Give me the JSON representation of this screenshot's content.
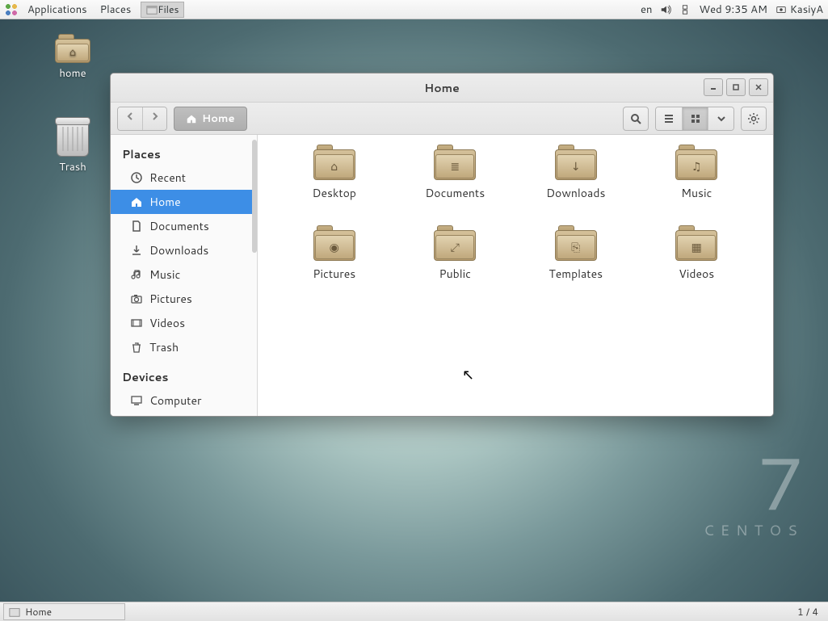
{
  "top_panel": {
    "applications": "Applications",
    "places": "Places",
    "task": "Files",
    "lang": "en",
    "clock": "Wed  9:35 AM",
    "user": "KasiyA"
  },
  "desktop": {
    "home": "home",
    "trash": "Trash"
  },
  "brand": {
    "seven": "7",
    "name": "CENTOS"
  },
  "bottom": {
    "task": "Home",
    "workspace": "1 / 4"
  },
  "window": {
    "title": "Home",
    "path_label": "Home",
    "sidebar": {
      "places_header": "Places",
      "devices_header": "Devices",
      "places": [
        {
          "icon": "clock",
          "label": "Recent"
        },
        {
          "icon": "home",
          "label": "Home"
        },
        {
          "icon": "doc",
          "label": "Documents"
        },
        {
          "icon": "down",
          "label": "Downloads"
        },
        {
          "icon": "music",
          "label": "Music"
        },
        {
          "icon": "camera",
          "label": "Pictures"
        },
        {
          "icon": "video",
          "label": "Videos"
        },
        {
          "icon": "trash",
          "label": "Trash"
        }
      ],
      "devices": [
        {
          "icon": "computer",
          "label": "Computer"
        }
      ]
    },
    "folders": [
      {
        "label": "Desktop",
        "glyph": "⌂"
      },
      {
        "label": "Documents",
        "glyph": "≣"
      },
      {
        "label": "Downloads",
        "glyph": "↓"
      },
      {
        "label": "Music",
        "glyph": "♫"
      },
      {
        "label": "Pictures",
        "glyph": "◉"
      },
      {
        "label": "Public",
        "glyph": "⤢"
      },
      {
        "label": "Templates",
        "glyph": "⎘"
      },
      {
        "label": "Videos",
        "glyph": "▦"
      }
    ]
  }
}
